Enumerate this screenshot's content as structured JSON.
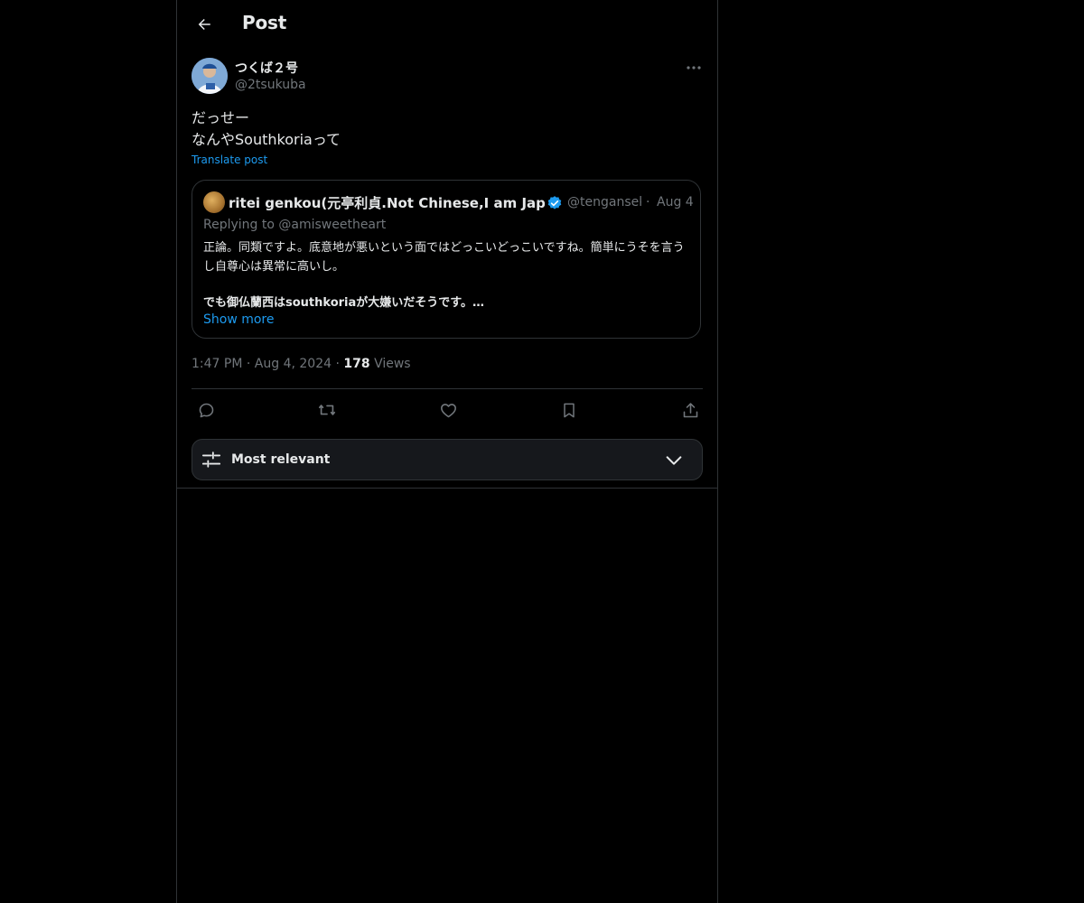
{
  "header": {
    "title": "Post"
  },
  "post": {
    "author_name": "つくば２号",
    "author_handle": "@2tsukuba",
    "text": "だっせー\nなんやSouthkoriaって",
    "translate_label": "Translate post",
    "time": "1:47 PM",
    "date": "Aug 4, 2024",
    "views_count": "178",
    "views_label": "Views"
  },
  "quote": {
    "author_name": "ritei genkou(元亭利貞.Not Chinese,I am Japanese)",
    "author_handle": "@tenganseki",
    "separator": "·",
    "date": "Aug 4",
    "replying": "Replying to @amisweetheart",
    "body_line1": "正論。同類ですよ。底意地が悪いという面ではどっこいどっこいですね。簡単にうそを言うし自尊心は異常に高いし。",
    "body_line2": "でも御仏蘭西はsouthkoriaが大嫌いだそうです。…",
    "show_more": "Show more"
  },
  "actions": {
    "reply_icon": "reply-icon",
    "repost_icon": "repost-icon",
    "like_icon": "heart-icon",
    "bookmark_icon": "bookmark-icon",
    "share_icon": "share-icon"
  },
  "sort": {
    "label": "Most relevant"
  },
  "colors": {
    "background": "#000000",
    "text": "#e7e9ea",
    "secondary": "#71767b",
    "accent": "#1d9bf0",
    "border": "#2f3336"
  }
}
